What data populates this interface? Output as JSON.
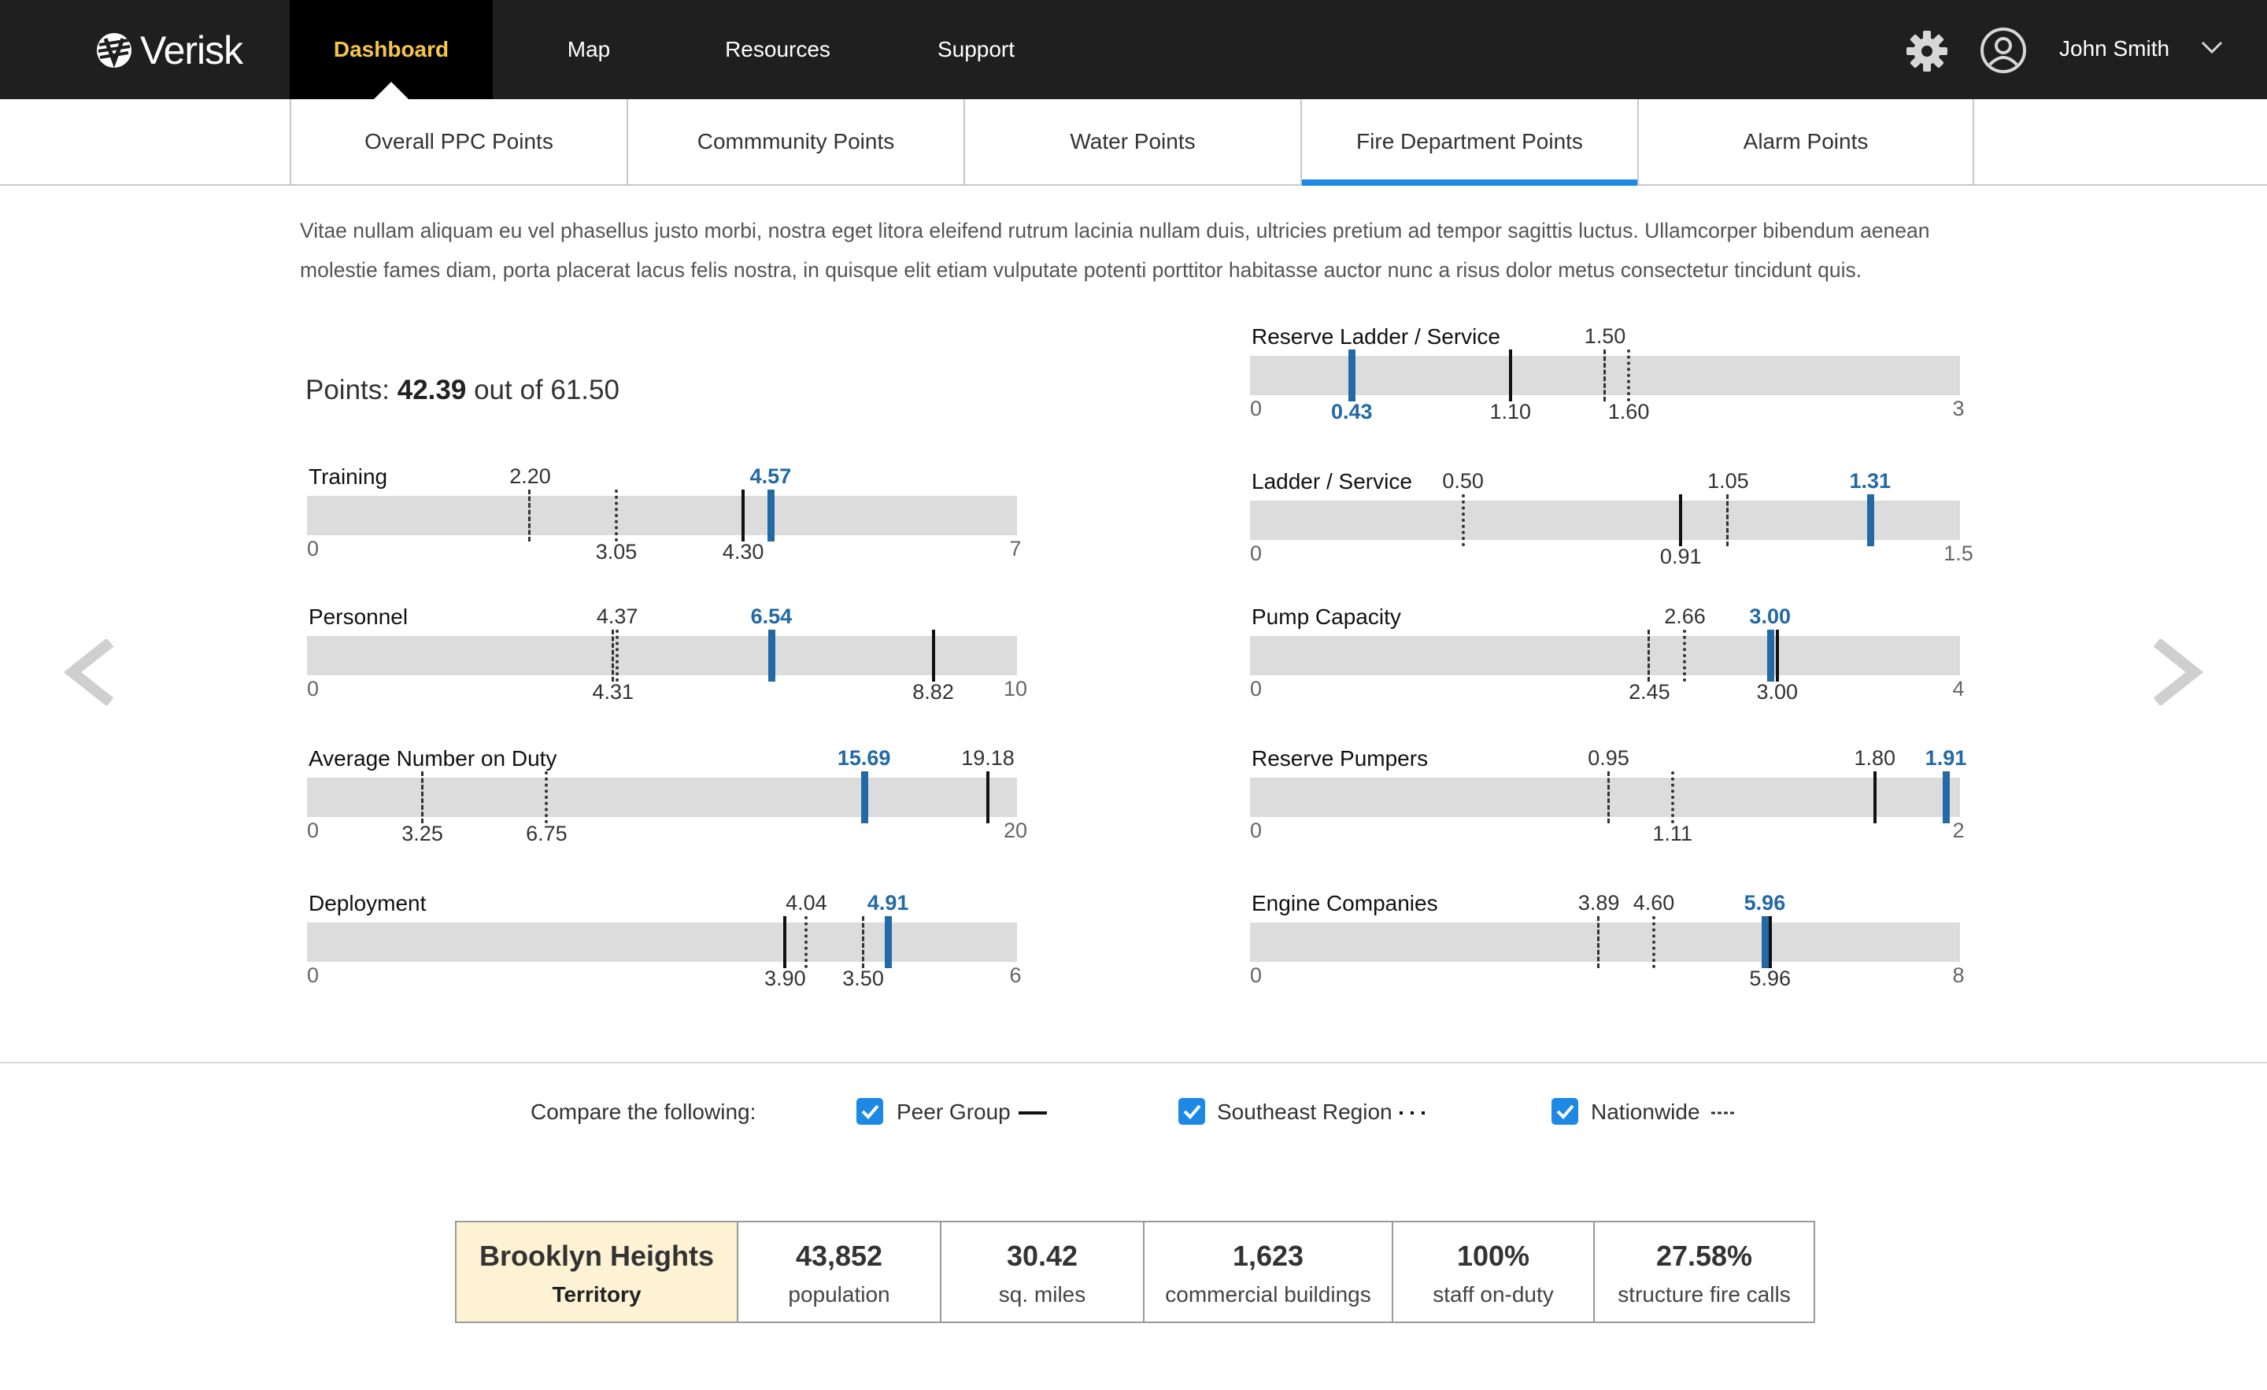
{
  "header": {
    "logo_text": "Verisk",
    "nav": [
      "Dashboard",
      "Map",
      "Resources",
      "Support"
    ],
    "active_nav": "Dashboard",
    "user_name": "John Smith"
  },
  "tabs": [
    "Overall PPC Points",
    "Commmunity Points",
    "Water Points",
    "Fire Department Points",
    "Alarm Points"
  ],
  "active_tab": "Fire Department Points",
  "intro": "Vitae nullam aliquam eu vel phasellus justo morbi, nostra eget litora eleifend rutrum lacinia nullam duis, ultricies pretium ad tempor sagittis luctus.  Ullamcorper bibendum aenean molestie fames diam, porta placerat lacus felis nostra, in quisque elit etiam vulputate potenti porttitor habitasse auctor nunc a risus dolor metus consectetur tincidunt quis.",
  "points": {
    "prefix": "Points:",
    "earned": "42.39",
    "suffix": "out of 61.50"
  },
  "colors": {
    "score": "#2369a5",
    "accent": "#1e88e5",
    "active_nav_text": "#f5c64a",
    "territory_bg": "#fdf3d4"
  },
  "metrics": [
    {
      "label": "Training",
      "max": 7,
      "min_label": "0",
      "max_label": "7",
      "score": {
        "value": 4.57,
        "label": "4.57"
      },
      "peer": {
        "value": 4.3,
        "label": "4.30"
      },
      "region": {
        "value": 3.05,
        "label": "3.05"
      },
      "nation": {
        "value": 2.2,
        "label": "2.20"
      }
    },
    {
      "label": "Personnel",
      "max": 10,
      "min_label": "0",
      "max_label": "10",
      "score": {
        "value": 6.54,
        "label": "6.54"
      },
      "peer": {
        "value": 8.82,
        "label": "8.82"
      },
      "region": {
        "value": 4.37,
        "label": "4.37"
      },
      "nation": {
        "value": 4.31,
        "label": "4.31"
      }
    },
    {
      "label": "Average Number on Duty",
      "max": 20,
      "min_label": "0",
      "max_label": "20",
      "score": {
        "value": 15.69,
        "label": "15.69"
      },
      "peer": {
        "value": 19.18,
        "label": "19.18"
      },
      "region": {
        "value": 6.75,
        "label": "6.75"
      },
      "nation": {
        "value": 3.25,
        "label": "3.25"
      }
    },
    {
      "label": "Deployment",
      "max": 6,
      "min_label": "0",
      "max_label": "6",
      "score": {
        "value": 4.91,
        "label": "4.91"
      },
      "peer": {
        "value": 4.04,
        "label": "3.90"
      },
      "region": {
        "value": 4.22,
        "label": "4.04"
      },
      "nation": {
        "value": 4.7,
        "label": "3.50"
      }
    },
    {
      "label": "Reserve Ladder / Service",
      "max": 3,
      "min_label": "0",
      "max_label": "3",
      "score": {
        "value": 0.43,
        "label": "0.43"
      },
      "peer": {
        "value": 1.1,
        "label": "1.10"
      },
      "region": {
        "value": 1.6,
        "label": "1.60"
      },
      "nation": {
        "value": 1.5,
        "label": "1.50"
      }
    },
    {
      "label": "Ladder / Service",
      "max": 1.5,
      "min_label": "0",
      "max_label": "1.5",
      "score": {
        "value": 1.31,
        "label": "1.31"
      },
      "peer": {
        "value": 0.91,
        "label": "0.91"
      },
      "region": {
        "value": 0.45,
        "label": "0.50"
      },
      "nation": {
        "value": 1.01,
        "label": "1.05"
      }
    },
    {
      "label": "Pump Capacity",
      "max": 4,
      "min_label": "0",
      "max_label": "4",
      "score": {
        "value": 2.93,
        "label": "3.00"
      },
      "peer": {
        "value": 2.97,
        "label": "3.00"
      },
      "region": {
        "value": 2.45,
        "label": "2.66"
      },
      "nation": {
        "value": 2.25,
        "label": "2.45"
      }
    },
    {
      "label": "Reserve Pumpers",
      "max": 2,
      "min_label": "0",
      "max_label": "2",
      "score": {
        "value": 1.96,
        "label": "1.91"
      },
      "peer": {
        "value": 1.76,
        "label": "1.80"
      },
      "region": {
        "value": 1.19,
        "label": "1.11"
      },
      "nation": {
        "value": 1.01,
        "label": "0.95"
      }
    },
    {
      "label": "Engine Companies",
      "max": 8,
      "min_label": "0",
      "max_label": "8",
      "score": {
        "value": 5.8,
        "label": "5.96"
      },
      "peer": {
        "value": 5.86,
        "label": "5.96"
      },
      "region": {
        "value": 4.55,
        "label": "4.60"
      },
      "nation": {
        "value": 3.93,
        "label": "3.89"
      }
    }
  ],
  "compare": {
    "label": "Compare the following:",
    "options": [
      {
        "label": "Peer Group",
        "checked": true
      },
      {
        "label": "Southeast Region",
        "checked": true
      },
      {
        "label": "Nationwide",
        "checked": true
      }
    ]
  },
  "stats": [
    {
      "value": "Brooklyn Heights",
      "label": "Territory"
    },
    {
      "value": "43,852",
      "label": "population"
    },
    {
      "value": "30.42",
      "label": "sq. miles"
    },
    {
      "value": "1,623",
      "label": "commercial buildings"
    },
    {
      "value": "100%",
      "label": "staff on-duty"
    },
    {
      "value": "27.58%",
      "label": "structure fire calls"
    }
  ]
}
